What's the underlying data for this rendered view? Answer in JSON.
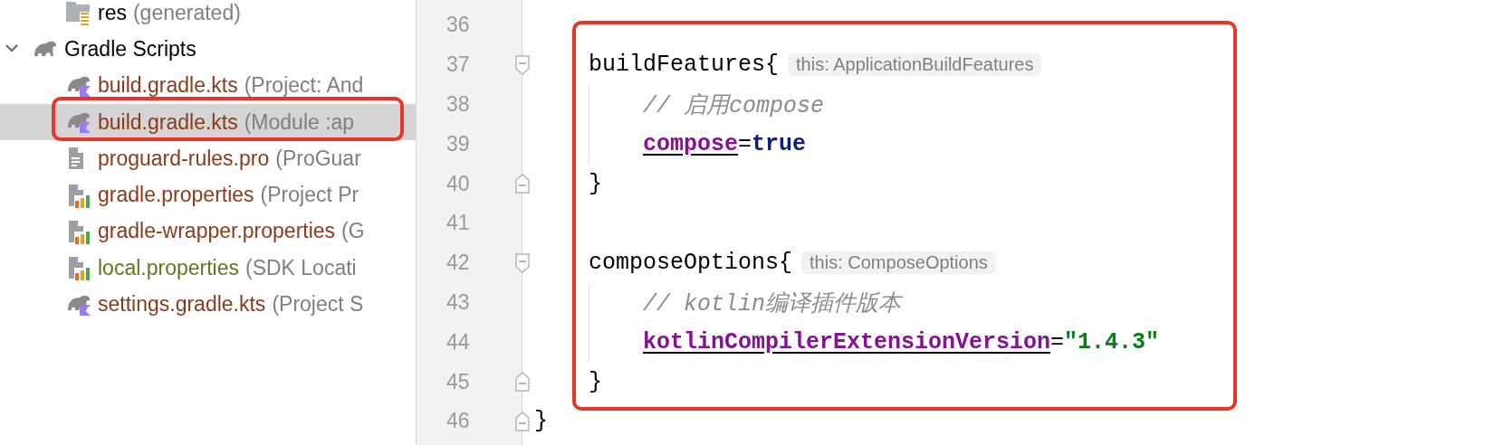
{
  "project_tree": {
    "continued_items": [
      {
        "kind": "res-folder",
        "name": "res",
        "hint": "(generated)",
        "color": "#000000",
        "selected": false,
        "highlighted": false
      }
    ],
    "items": [
      {
        "kind": "gradle-group",
        "name": "Gradle Scripts",
        "color": "#000000",
        "selected": false,
        "highlighted": false,
        "expanded": true,
        "children": [
          {
            "kind": "gradle-kts",
            "name": "build.gradle.kts",
            "hint": "(Project: And",
            "color": "#8b3a1b",
            "selected": false,
            "highlighted": false
          },
          {
            "kind": "gradle-kts",
            "name": "build.gradle.kts",
            "hint": "(Module :ap",
            "color": "#8b3a1b",
            "selected": true,
            "highlighted": true
          },
          {
            "kind": "text-file",
            "name": "proguard-rules.pro",
            "hint": "(ProGuar",
            "color": "#8b3a1b",
            "selected": false,
            "highlighted": false
          },
          {
            "kind": "properties",
            "name": "gradle.properties",
            "hint": "(Project Pr",
            "color": "#8b3a1b",
            "selected": false,
            "highlighted": false
          },
          {
            "kind": "properties",
            "name": "gradle-wrapper.properties",
            "hint": "(G",
            "color": "#8b3a1b",
            "selected": false,
            "highlighted": false
          },
          {
            "kind": "properties",
            "name": "local.properties",
            "hint": "(SDK Locati",
            "color": "#62771f",
            "selected": false,
            "highlighted": false
          },
          {
            "kind": "gradle-kts",
            "name": "settings.gradle.kts",
            "hint": "(Project S",
            "color": "#8b3a1b",
            "selected": false,
            "highlighted": false
          }
        ]
      }
    ]
  },
  "editor": {
    "continued_lines": [
      {
        "number": "36",
        "fold_open": false,
        "fold_close": false,
        "highlighted": false
      },
      {
        "number": "37",
        "fold_open": true,
        "fold_close": false,
        "highlighted": true,
        "tokens": [
          {
            "kind": "text",
            "text": "buildFeatures{"
          },
          {
            "kind": "hint",
            "text": "this: ApplicationBuildFeatures"
          }
        ],
        "children": [
          {
            "number": "38",
            "fold_open": false,
            "fold_close": false,
            "tokens": [
              {
                "kind": "comment",
                "text": "// 启用compose"
              }
            ]
          },
          {
            "number": "39",
            "fold_open": false,
            "fold_close": false,
            "tokens": [
              {
                "kind": "property",
                "text": "compose"
              },
              {
                "kind": "text",
                "text": "="
              },
              {
                "kind": "keyword",
                "text": "true"
              }
            ]
          }
        ]
      },
      {
        "number": "40",
        "fold_open": false,
        "fold_close": true,
        "highlighted": true,
        "tokens": [
          {
            "kind": "text",
            "text": "}"
          }
        ]
      },
      {
        "number": "41",
        "fold_open": false,
        "fold_close": false,
        "highlighted": true
      },
      {
        "number": "42",
        "fold_open": true,
        "fold_close": false,
        "highlighted": true,
        "tokens": [
          {
            "kind": "text",
            "text": "composeOptions{"
          },
          {
            "kind": "hint",
            "text": "this: ComposeOptions"
          }
        ],
        "children": [
          {
            "number": "43",
            "fold_open": false,
            "fold_close": false,
            "tokens": [
              {
                "kind": "comment",
                "text": "// kotlin编译插件版本"
              }
            ]
          },
          {
            "number": "44",
            "fold_open": false,
            "fold_close": false,
            "tokens": [
              {
                "kind": "property",
                "text": "kotlinCompilerExtensionVersion"
              },
              {
                "kind": "text",
                "text": "="
              },
              {
                "kind": "string",
                "text": "\"1.4.3\""
              }
            ]
          }
        ]
      },
      {
        "number": "45",
        "fold_open": false,
        "fold_close": true,
        "highlighted": true,
        "tokens": [
          {
            "kind": "text",
            "text": "}"
          }
        ]
      }
    ],
    "lines": [
      {
        "number": "46",
        "fold_open": false,
        "fold_close": true,
        "highlighted": false,
        "tokens": [
          {
            "kind": "text",
            "text": "}"
          }
        ]
      }
    ]
  }
}
